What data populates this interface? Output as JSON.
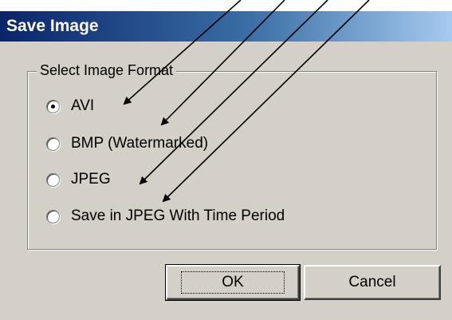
{
  "dialog": {
    "title": "Save Image",
    "group_label": "Select Image Format",
    "options": [
      {
        "label": "AVI",
        "checked": true
      },
      {
        "label": "BMP (Watermarked)",
        "checked": false
      },
      {
        "label": "JPEG",
        "checked": false
      },
      {
        "label": "Save in JPEG With Time Period",
        "checked": false
      }
    ],
    "ok_label": "OK",
    "cancel_label": "Cancel"
  },
  "colors": {
    "titlebar_start": "#0a246a",
    "titlebar_end": "#a6caf0",
    "window_face": "#d4d0c8",
    "annotation_arrow": "#000000"
  }
}
